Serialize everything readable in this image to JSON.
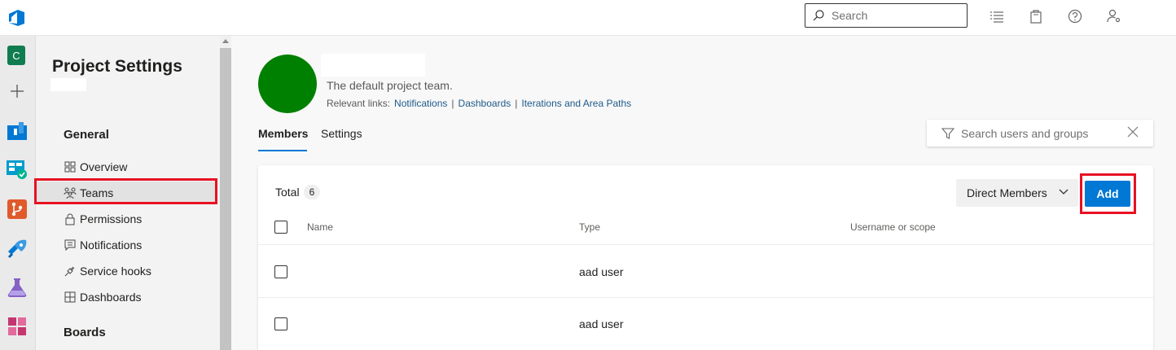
{
  "header": {
    "search_placeholder": "Search",
    "icons": [
      "list-icon",
      "shopping-bag-icon",
      "help-icon",
      "user-settings-icon"
    ]
  },
  "rail": {
    "project_initial": "C",
    "icons": [
      "add-icon",
      "overview-icon",
      "boards-icon",
      "repos-icon",
      "pipelines-icon",
      "test-plans-icon",
      "artifacts-icon"
    ]
  },
  "nav": {
    "title": "Project Settings",
    "group_general": "General",
    "items": [
      {
        "label": "Overview",
        "icon": "overview-icon"
      },
      {
        "label": "Teams",
        "icon": "teams-icon"
      },
      {
        "label": "Permissions",
        "icon": "lock-icon"
      },
      {
        "label": "Notifications",
        "icon": "chat-icon"
      },
      {
        "label": "Service hooks",
        "icon": "plug-icon"
      },
      {
        "label": "Dashboards",
        "icon": "dashboard-icon"
      }
    ],
    "group_boards": "Boards"
  },
  "team": {
    "description": "The default project team.",
    "links_label": "Relevant links:",
    "links": [
      "Notifications",
      "Dashboards",
      "Iterations and Area Paths"
    ]
  },
  "tabs": [
    "Members",
    "Settings"
  ],
  "filter": {
    "placeholder": "Search users and groups"
  },
  "members": {
    "total_label": "Total",
    "total_count": "6",
    "scope_dropdown": "Direct Members",
    "add_label": "Add",
    "columns": [
      "Name",
      "Type",
      "Username or scope"
    ],
    "rows": [
      {
        "name": "",
        "type": "aad user",
        "scope": ""
      },
      {
        "name": "",
        "type": "aad user",
        "scope": ""
      }
    ]
  },
  "colors": {
    "accent": "#0078d4",
    "avatar": "#008000",
    "highlight": "#e81123"
  }
}
